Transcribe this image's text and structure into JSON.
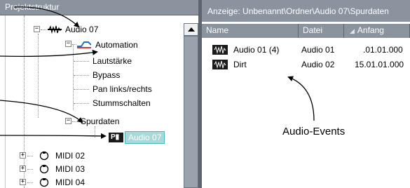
{
  "left_pane": {
    "header": "Projektstruktur",
    "tree": {
      "audio_track": "Audio 07",
      "automation": "Automation",
      "automation_items": [
        "Lautstärke",
        "Bypass",
        "Pan links/rechts",
        "Stummschalten"
      ],
      "spurdaten": "Spurdaten",
      "selected_event": "Audio 07",
      "selected_event_badge": "P",
      "midi_tracks": [
        "MIDI 02",
        "MIDI 03",
        "MIDI 04"
      ]
    }
  },
  "right_pane": {
    "header": "Anzeige: Unbenannt\\Ordner\\Audio 07\\Spurdaten",
    "columns": [
      "Name",
      "Datei",
      "Anfang"
    ],
    "rows": [
      {
        "name": "Audio 01 (4)",
        "file": "Audio 01",
        "start": ".01.01.000"
      },
      {
        "name": "Dirt",
        "file": "Audio 02",
        "start": "15.01.01.000"
      }
    ]
  },
  "annotation": {
    "audio_events_label": "Audio-Events"
  },
  "colors": {
    "panel_header": "#8a939e",
    "selection": "#a8d8d8",
    "selection_border": "#48b8b8",
    "automation_line": "#1a73c7"
  }
}
